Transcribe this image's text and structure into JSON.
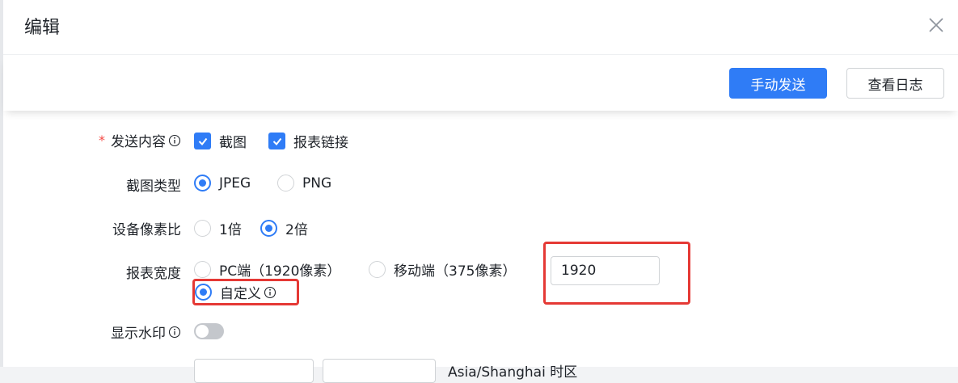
{
  "dialog": {
    "title": "编辑",
    "toolbar": {
      "send_label": "手动发送",
      "log_label": "查看日志"
    }
  },
  "form": {
    "send_content": {
      "label": "发送内容",
      "required": true,
      "options": [
        {
          "label": "截图",
          "checked": true
        },
        {
          "label": "报表链接",
          "checked": true
        }
      ]
    },
    "screenshot_type": {
      "label": "截图类型",
      "options": [
        {
          "label": "JPEG",
          "checked": true
        },
        {
          "label": "PNG",
          "checked": false
        }
      ]
    },
    "pixel_ratio": {
      "label": "设备像素比",
      "options": [
        {
          "label": "1倍",
          "checked": false
        },
        {
          "label": "2倍",
          "checked": true
        }
      ]
    },
    "report_width": {
      "label": "报表宽度",
      "options": [
        {
          "label": "PC端（1920像素）",
          "checked": false
        },
        {
          "label": "移动端（375像素）",
          "checked": false
        },
        {
          "label": "自定义",
          "checked": true
        }
      ],
      "custom_value": "1920"
    },
    "watermark": {
      "label": "显示水印",
      "enabled": false
    },
    "timezone_partial": "Asia/Shanghai 时区"
  },
  "colors": {
    "primary": "#2f7cf6",
    "highlight": "#e53935",
    "required": "#f54a45"
  }
}
